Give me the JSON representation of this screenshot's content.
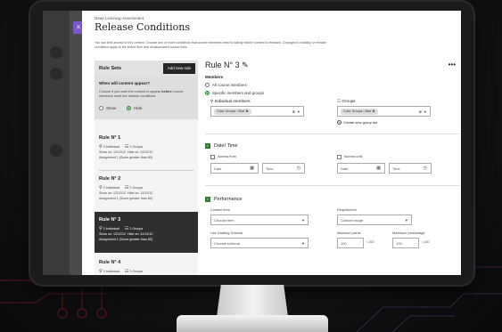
{
  "app": {
    "subtitle": "Deep Learning Assessment",
    "title": "Release Conditions",
    "description": "You can limit access to this content. Choose one or more conditions that course members need to satisfy before content is released. Changes to visibility or release conditions apply to the linked item and all associated course links.",
    "close_label": "×"
  },
  "rule_sets": {
    "header": "Rule Sets",
    "add_button": "Add new rule",
    "visibility": {
      "question": "When will content appear?",
      "description_part1": "Choose if you want the content to appear ",
      "description_bold": "before",
      "description_part2": " course members meet the release conditions",
      "options": [
        "Show",
        "Hide"
      ],
      "selected": "Hide"
    },
    "rules": [
      {
        "name": "Rule N° 1",
        "individual": "3 Individual",
        "groups": "2 Groups",
        "show_on": "Show on: 12/12/12",
        "hide_on": "Hide on: 12/12/12",
        "assignment": "Assignment 1 (Score greater than 80)",
        "selected": false
      },
      {
        "name": "Rule N° 2",
        "individual": "3 Individual",
        "groups": "2 Groups",
        "show_on": "Show on: 12/12/12",
        "hide_on": "Hide on: 12/12/12",
        "assignment": "Assignment 1 (Score greater than 80)",
        "selected": false
      },
      {
        "name": "Rule N° 3",
        "individual": "3 Individual",
        "groups": "2 Groups",
        "show_on": "Show on: 12/12/12",
        "hide_on": "Hide on: 12/12/12",
        "assignment": "Assignment 1 (Score greater than 80)",
        "selected": true
      },
      {
        "name": "Rule N° 4",
        "individual": "3 Individual",
        "groups": "2 Groups",
        "selected": false
      }
    ]
  },
  "rule_detail": {
    "title": "Rule N° 3",
    "more": "•••",
    "members": {
      "label": "Members",
      "options": [
        "All course members",
        "Specific members and groups"
      ],
      "selected": "Specific members and groups",
      "individual_label": "Individual members",
      "individual_chip": "Color Groups : Blue",
      "groups_label": "Groups",
      "groups_chip": "Color Groups : Blue",
      "create_group": "Create new group set"
    },
    "date_time": {
      "label": "Date/ Time",
      "access_from": "Access from",
      "access_until": "Access until",
      "date_placeholder": "Date",
      "time_placeholder": "Time"
    },
    "performance": {
      "label": "Performance",
      "content_item_label": "Content Item",
      "content_item_value": "Choose item",
      "requirement_label": "Requirement",
      "requirement_value": "Custom range",
      "grading_label": "Use Grading Schema",
      "grading_value": "Choose schema",
      "min_points_label": "Minimum points",
      "min_points_value": "100",
      "max_pct_label": "Maximum percentage",
      "max_pct_value": "100",
      "denominator": "/ 100"
    }
  },
  "colors": {
    "accent_purple": "#7b58c9",
    "check_green": "#2e7d32",
    "selected_rule_bg": "#2f2f2f"
  }
}
